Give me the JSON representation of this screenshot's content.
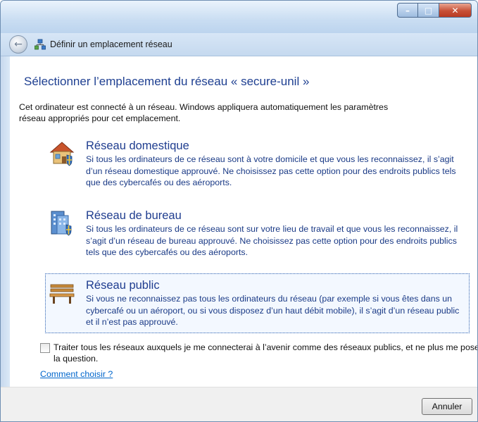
{
  "window": {
    "nav_title": "Définir un emplacement réseau",
    "controls": {
      "minimize": "–",
      "maximize": "□",
      "close": "✕"
    }
  },
  "content": {
    "heading": "Sélectionner l’emplacement du réseau « secure-unil »",
    "intro": "Cet ordinateur est connecté à un réseau. Windows appliquera automatiquement les paramètres réseau appropriés pour cet emplacement.",
    "options": [
      {
        "title": "Réseau domestique",
        "desc": "Si tous les ordinateurs de ce réseau sont à votre domicile et que vous les reconnaissez, il s’agit d’un réseau domestique approuvé. Ne choisissez pas cette option pour des endroits publics tels que des cybercafés ou des aéroports.",
        "icon": "home-network-icon"
      },
      {
        "title": "Réseau de bureau",
        "desc": "Si tous les ordinateurs de ce réseau sont sur votre lieu de travail et que vous les reconnaissez, il s’agit d’un réseau de bureau approuvé. Ne choisissez pas cette option pour des endroits publics tels que des cybercafés ou des aéroports.",
        "icon": "work-network-icon"
      },
      {
        "title": "Réseau public",
        "desc": "Si vous ne reconnaissez pas tous les ordinateurs du réseau (par exemple si vous êtes dans un cybercafé ou un aéroport, ou si vous disposez d’un haut débit mobile), il s’agit d’un réseau public et il n’est pas approuvé.",
        "icon": "public-network-bench-icon"
      }
    ],
    "checkbox_label": "Traiter tous les réseaux auxquels je me connecterai à l’avenir comme des réseaux publics, et ne plus me poser la question.",
    "checkbox_checked": false,
    "help_link": "Comment choisir ?"
  },
  "footer": {
    "cancel_label": "Annuler"
  },
  "colors": {
    "heading": "#1e3f91",
    "link": "#0066cc",
    "option_text": "#1a3a86"
  }
}
